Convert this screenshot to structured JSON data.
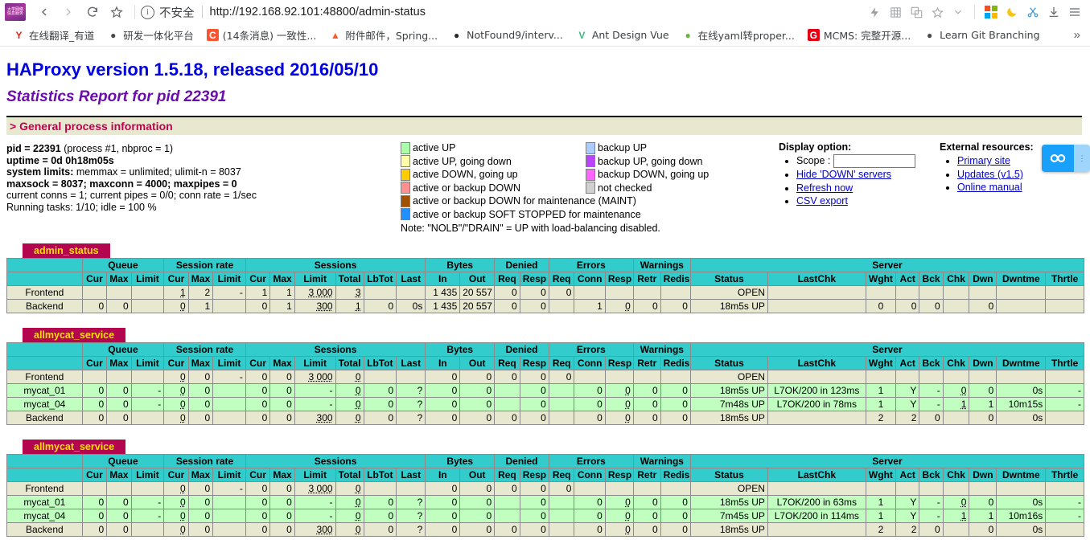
{
  "browser": {
    "url": "http://192.168.92.101:48800/admin-status",
    "security_label": "不安全",
    "logo_text": "大学网络信息化服务",
    "nav": {
      "back": "back-arrow",
      "forward": "forward-arrow",
      "reload": "reload-icon",
      "bookmark": "star-icon"
    },
    "bookmarks": [
      {
        "label": "在线翻译_有道",
        "fav": "Y",
        "favbg": "#ffffff",
        "favcolor": "#e2231a"
      },
      {
        "label": "研发一体化平台",
        "fav": "●",
        "favbg": "#ffffff",
        "favcolor": "#4a4a4a"
      },
      {
        "label": "(14条消息) 一致性...",
        "fav": "C",
        "favbg": "#fc5531",
        "favcolor": "#ffffff"
      },
      {
        "label": "附件邮件，Spring...",
        "fav": "▲",
        "favbg": "#ffffff",
        "favcolor": "#ff5722"
      },
      {
        "label": "NotFound9/interv...",
        "fav": "●",
        "favbg": "#ffffff",
        "favcolor": "#24292e"
      },
      {
        "label": "Ant Design Vue",
        "fav": "V",
        "favbg": "#ffffff",
        "favcolor": "#42b883"
      },
      {
        "label": "在线yaml转proper...",
        "fav": "●",
        "favbg": "#ffffff",
        "favcolor": "#6db33f"
      },
      {
        "label": "MCMS: 完整开源...",
        "fav": "G",
        "favbg": "#e60012",
        "favcolor": "#ffffff"
      },
      {
        "label": "Learn Git Branching",
        "fav": "●",
        "favbg": "#ffffff",
        "favcolor": "#4a4a4a"
      }
    ],
    "bookmarks_overflow": "»"
  },
  "header": {
    "title": "HAProxy version 1.5.18, released 2016/05/10",
    "subtitle": "Statistics Report for pid 22391",
    "section": "> General process information"
  },
  "process_info": {
    "lines": [
      {
        "b": "pid = 22391",
        "t": " (process #1, nbproc = 1)"
      },
      {
        "b": "uptime = 0d 0h18m05s",
        "t": ""
      },
      {
        "b": "system limits:",
        "t": " memmax = unlimited; ulimit-n = 8037"
      },
      {
        "b": "maxsock = 8037; maxconn = 4000; maxpipes = 0",
        "t": ""
      },
      {
        "b": "",
        "t": "current conns = 1; current pipes = 0/0; conn rate = 1/sec"
      },
      {
        "b": "",
        "t": "Running tasks: 1/10; idle = 100 %"
      }
    ]
  },
  "legend": {
    "left": [
      {
        "label": "active UP",
        "color": "#aaffaa"
      },
      {
        "label": "active UP, going down",
        "color": "#ffffaa"
      },
      {
        "label": "active DOWN, going up",
        "color": "#ffcc00"
      },
      {
        "label": "active or backup DOWN",
        "color": "#ff9090"
      },
      {
        "label": "active or backup DOWN for maintenance (MAINT)",
        "color": "#a05000"
      },
      {
        "label": "active or backup SOFT STOPPED for maintenance",
        "color": "#1e90ff"
      }
    ],
    "right": [
      {
        "label": "backup UP",
        "color": "#aaccff"
      },
      {
        "label": "backup UP, going down",
        "color": "#bb44ff"
      },
      {
        "label": "backup DOWN, going up",
        "color": "#ff66ff"
      },
      {
        "label": "not checked",
        "color": "#d0d0d0"
      }
    ],
    "note": "Note: \"NOLB\"/\"DRAIN\" = UP with load-balancing disabled."
  },
  "display_option": {
    "title": "Display option:",
    "scope_label": "Scope :",
    "scope_value": "",
    "scope_placeholder": "",
    "links": [
      "Hide 'DOWN' servers",
      "Refresh now",
      "CSV export"
    ]
  },
  "external_resources": {
    "title": "External resources:",
    "links": [
      "Primary site",
      "Updates (v1.5)",
      "Online manual"
    ]
  },
  "float_widget": {
    "icon": "infinity-icon",
    "side_text": "⋮"
  },
  "table_columns": {
    "groups": [
      "",
      "Queue",
      "Session rate",
      "Sessions",
      "Bytes",
      "Denied",
      "Errors",
      "Warnings",
      "Server"
    ],
    "sub": [
      "",
      "Cur",
      "Max",
      "Limit",
      "Cur",
      "Max",
      "Limit",
      "Cur",
      "Max",
      "Limit",
      "Total",
      "LbTot",
      "Last",
      "In",
      "Out",
      "Req",
      "Resp",
      "Req",
      "Conn",
      "Resp",
      "Retr",
      "Redis",
      "Status",
      "LastChk",
      "Wght",
      "Act",
      "Bck",
      "Chk",
      "Dwn",
      "Dwntme",
      "Thrtle"
    ]
  },
  "proxies": [
    {
      "name": "admin_status",
      "rows": [
        {
          "kind": "fe",
          "name": "Frontend",
          "cells": [
            "",
            "",
            "",
            "1",
            "2",
            "-",
            "1",
            "1",
            "3 000",
            "3",
            "",
            "",
            "1 435",
            "20 557",
            "0",
            "0",
            "0",
            "",
            "",
            "",
            "",
            "OPEN",
            "",
            "",
            "",
            "",
            "",
            "",
            "",
            ""
          ]
        },
        {
          "kind": "be",
          "name": "Backend",
          "cells": [
            "0",
            "0",
            "",
            "0",
            "1",
            "",
            "0",
            "1",
            "300",
            "1",
            "0",
            "0s",
            "1 435",
            "20 557",
            "0",
            "0",
            "",
            "1",
            "0",
            "0",
            "0",
            "18m5s UP",
            "",
            "0",
            "0",
            "0",
            "",
            "0",
            "",
            ""
          ]
        }
      ]
    },
    {
      "name": "allmycat_service",
      "rows": [
        {
          "kind": "fe",
          "name": "Frontend",
          "cells": [
            "",
            "",
            "",
            "0",
            "0",
            "-",
            "0",
            "0",
            "3 000",
            "0",
            "",
            "",
            "0",
            "0",
            "0",
            "0",
            "0",
            "",
            "",
            "",
            "",
            "OPEN",
            "",
            "",
            "",
            "",
            "",
            "",
            "",
            ""
          ]
        },
        {
          "kind": "srv",
          "name": "mycat_01",
          "cells": [
            "0",
            "0",
            "-",
            "0",
            "0",
            "",
            "0",
            "0",
            "-",
            "0",
            "0",
            "?",
            "0",
            "0",
            "",
            "0",
            "",
            "0",
            "0",
            "0",
            "0",
            "18m5s UP",
            "L7OK/200 in 123ms",
            "1",
            "Y",
            "-",
            "0",
            "0",
            "0s",
            "-"
          ]
        },
        {
          "kind": "srv",
          "name": "mycat_04",
          "cells": [
            "0",
            "0",
            "-",
            "0",
            "0",
            "",
            "0",
            "0",
            "-",
            "0",
            "0",
            "?",
            "0",
            "0",
            "",
            "0",
            "",
            "0",
            "0",
            "0",
            "0",
            "7m48s UP",
            "L7OK/200 in 78ms",
            "1",
            "Y",
            "-",
            "1",
            "1",
            "10m15s",
            "-"
          ]
        },
        {
          "kind": "be",
          "name": "Backend",
          "cells": [
            "0",
            "0",
            "",
            "0",
            "0",
            "",
            "0",
            "0",
            "300",
            "0",
            "0",
            "?",
            "0",
            "0",
            "0",
            "0",
            "",
            "0",
            "0",
            "0",
            "0",
            "18m5s UP",
            "",
            "2",
            "2",
            "0",
            "",
            "0",
            "0s",
            ""
          ]
        }
      ]
    },
    {
      "name": "allmycat_service",
      "rows": [
        {
          "kind": "fe",
          "name": "Frontend",
          "cells": [
            "",
            "",
            "",
            "0",
            "0",
            "-",
            "0",
            "0",
            "3 000",
            "0",
            "",
            "",
            "0",
            "0",
            "0",
            "0",
            "0",
            "",
            "",
            "",
            "",
            "OPEN",
            "",
            "",
            "",
            "",
            "",
            "",
            "",
            ""
          ]
        },
        {
          "kind": "srv",
          "name": "mycat_01",
          "cells": [
            "0",
            "0",
            "-",
            "0",
            "0",
            "",
            "0",
            "0",
            "-",
            "0",
            "0",
            "?",
            "0",
            "0",
            "",
            "0",
            "",
            "0",
            "0",
            "0",
            "0",
            "18m5s UP",
            "L7OK/200 in 63ms",
            "1",
            "Y",
            "-",
            "0",
            "0",
            "0s",
            "-"
          ]
        },
        {
          "kind": "srv",
          "name": "mycat_04",
          "cells": [
            "0",
            "0",
            "-",
            "0",
            "0",
            "",
            "0",
            "0",
            "-",
            "0",
            "0",
            "?",
            "0",
            "0",
            "",
            "0",
            "",
            "0",
            "0",
            "0",
            "0",
            "7m45s UP",
            "L7OK/200 in 114ms",
            "1",
            "Y",
            "-",
            "1",
            "1",
            "10m16s",
            "-"
          ]
        },
        {
          "kind": "be",
          "name": "Backend",
          "cells": [
            "0",
            "0",
            "",
            "0",
            "0",
            "",
            "0",
            "0",
            "300",
            "0",
            "0",
            "?",
            "0",
            "0",
            "0",
            "0",
            "",
            "0",
            "0",
            "0",
            "0",
            "18m5s UP",
            "",
            "2",
            "2",
            "0",
            "",
            "0",
            "0s",
            ""
          ]
        }
      ]
    }
  ],
  "colors": {
    "header_cyan": "#33cccc",
    "row_beige": "#e8e8d0",
    "row_green": "#c0ffc0",
    "proxy_badge": "#b3064f",
    "proxy_badge_text": "#ffe000",
    "title_blue": "#0000e0",
    "subtitle_purple": "#6a0dad",
    "section_red": "#c00050"
  }
}
